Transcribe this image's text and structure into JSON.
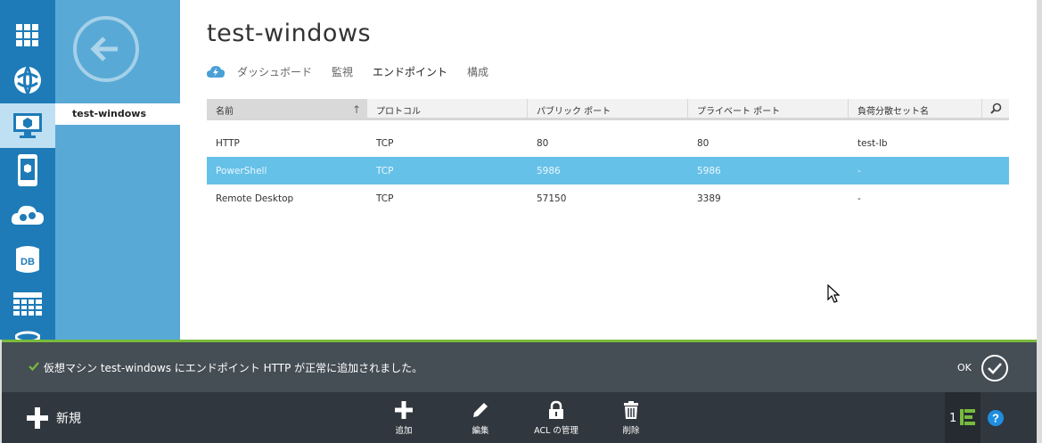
{
  "subnav": {
    "item": "test-windows"
  },
  "main": {
    "title": "test-windows",
    "tabs": [
      "ダッシュボード",
      "監視",
      "エンドポイント",
      "構成"
    ],
    "active_tab": "エンドポイント"
  },
  "grid": {
    "columns": [
      "名前",
      "プロトコル",
      "パブリック ポート",
      "プライベート ポート",
      "負荷分散セット名"
    ],
    "sorted_column": "名前",
    "rows": [
      {
        "name": "HTTP",
        "protocol": "TCP",
        "public_port": "80",
        "private_port": "80",
        "lb_set": "test-lb",
        "selected": false
      },
      {
        "name": "PowerShell",
        "protocol": "TCP",
        "public_port": "5986",
        "private_port": "5986",
        "lb_set": "-",
        "selected": true
      },
      {
        "name": "Remote Desktop",
        "protocol": "TCP",
        "public_port": "57150",
        "private_port": "3389",
        "lb_set": "-",
        "selected": false
      }
    ]
  },
  "notification": {
    "message": "仮想マシン test-windows にエンドポイント HTTP が正常に追加されました。",
    "ok_label": "OK"
  },
  "commandbar": {
    "new_label": "新規",
    "commands": [
      "追加",
      "編集",
      "ACL の管理",
      "削除"
    ],
    "status_count": "1"
  },
  "colors": {
    "rail": "#1e7bb8",
    "subnav": "#59a9d6",
    "selected_row": "#66c1e8",
    "notify_bg": "#454d55",
    "notify_accent": "#78bb3e",
    "commandbar_bg": "#30373e"
  },
  "icons": [
    "all-items-icon",
    "web-sites-icon",
    "virtual-machines-icon",
    "mobile-services-icon",
    "cloud-services-icon",
    "sql-databases-icon",
    "storage-icon",
    "hdinsight-icon",
    "back-arrow-icon",
    "quick-start-icon",
    "search-icon",
    "sort-up-icon",
    "check-icon",
    "ok-circle-icon",
    "plus-icon",
    "pencil-icon",
    "lock-icon",
    "trash-icon",
    "status-list-icon",
    "help-icon"
  ]
}
